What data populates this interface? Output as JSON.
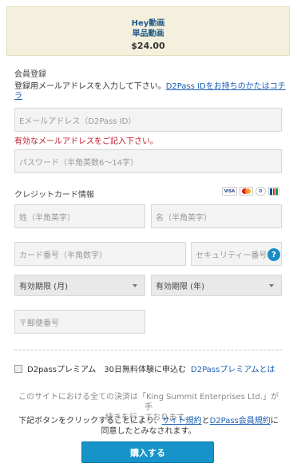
{
  "summary": {
    "title_line1": "Hey動画",
    "title_line2": "単品動画",
    "price": "$24.00"
  },
  "account": {
    "section_title": "会員登録",
    "hint_text": "登録用メールアドレスを入力して下さい。",
    "hint_link": "D2Pass IDをお持ちのかたはコチラ",
    "email_placeholder": "Eメールアドレス（D2Pass ID）",
    "email_error": "有効なメールアドレスをご記入下さい。",
    "password_placeholder": "パスワード（半角英数6〜14字）"
  },
  "card": {
    "section_title": "クレジットカード情報",
    "brand_icons": [
      "visa-icon",
      "mastercard-icon",
      "diners-icon",
      "jcb-icon"
    ],
    "visa_label": "VISA",
    "diners_label": "D",
    "last_name_placeholder": "姓（半角英字）",
    "first_name_placeholder": "名（半角英字）",
    "number_placeholder": "カード番号（半角数字）",
    "cvv_placeholder": "セキュリティー番号",
    "help_icon": "?",
    "expiry_month": "有効期限 (月)",
    "expiry_year": "有効期限 (年)",
    "postal_placeholder": "〒郵便番号"
  },
  "premium": {
    "label": "D2passプレミアム",
    "offer": "30日無料体験に申込む",
    "link": "D2Passプレミアムとは"
  },
  "notes": {
    "settlement_line1": "このサイトにおける全ての決済は「King Summit Enterprises Ltd.」が手",
    "settlement_line2": "続きを行っております。",
    "agree_prefix": "下記ボタンをクリックすることにより、",
    "terms_link": "サイト規約",
    "and": "と",
    "member_terms_link": "D2Pass会員規約",
    "agree_suffix": "に",
    "agree_line2": "同意したとみなされます。"
  },
  "buy_button": "購入する",
  "colors": {
    "accent": "#1694c9",
    "link": "#1a5fb4",
    "error": "#c0182a",
    "summary_bg": "#f5f0dd"
  }
}
